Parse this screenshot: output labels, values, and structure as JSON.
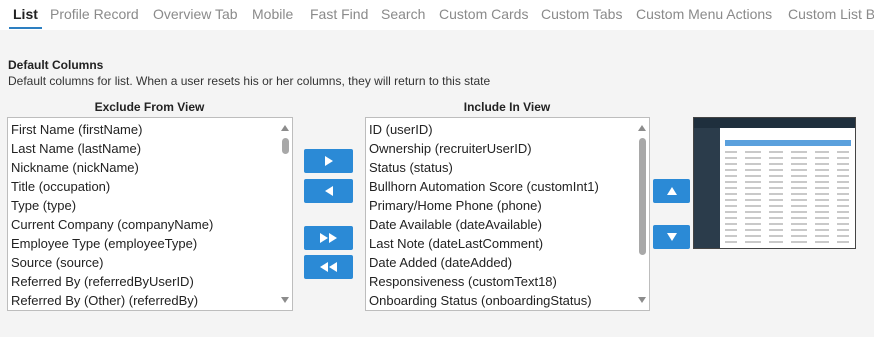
{
  "tabs": [
    {
      "label": "List",
      "active": true
    },
    {
      "label": "Profile Record",
      "active": false
    },
    {
      "label": "Overview Tab",
      "active": false
    },
    {
      "label": "Mobile",
      "active": false
    },
    {
      "label": "Fast Find",
      "active": false
    },
    {
      "label": "Search",
      "active": false
    },
    {
      "label": "Custom Cards",
      "active": false
    },
    {
      "label": "Custom Tabs",
      "active": false
    },
    {
      "label": "Custom Menu Actions",
      "active": false
    },
    {
      "label": "Custom List B",
      "active": false
    }
  ],
  "section": {
    "title": "Default Columns",
    "description": "Default columns for list. When a user resets his or her columns, they will return to this state"
  },
  "exclude": {
    "title": "Exclude From View",
    "items": [
      "First Name (firstName)",
      "Last Name (lastName)",
      "Nickname (nickName)",
      "Title (occupation)",
      "Type (type)",
      "Current Company (companyName)",
      "Employee Type (employeeType)",
      "Source (source)",
      "Referred By (referredByUserID)",
      "Referred By (Other) (referredBy)"
    ]
  },
  "include": {
    "title": "Include In View",
    "items": [
      "ID (userID)",
      "Ownership (recruiterUserID)",
      "Status (status)",
      "Bullhorn Automation Score (customInt1)",
      "Primary/Home Phone (phone)",
      "Date Available (dateAvailable)",
      "Last Note (dateLastComment)",
      "Date Added (dateAdded)",
      "Responsiveness (customText18)",
      "Onboarding Status (onboardingStatus)"
    ]
  },
  "buttons": {
    "move_right": "right-arrow-icon",
    "move_left": "left-arrow-icon",
    "move_all_right": "double-right-arrow-icon",
    "move_all_left": "double-left-arrow-icon",
    "move_up": "up-arrow-icon",
    "move_down": "down-arrow-icon"
  },
  "colors": {
    "accent": "#2b8ad6",
    "active_tab": "#2d7fc1"
  }
}
